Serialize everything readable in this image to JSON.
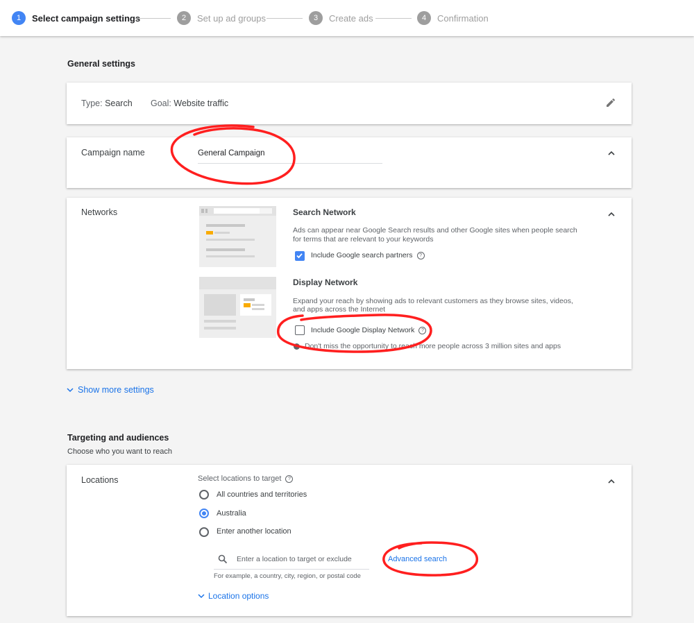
{
  "stepper": {
    "steps": [
      {
        "num": "1",
        "label": "Select campaign settings"
      },
      {
        "num": "2",
        "label": "Set up ad groups"
      },
      {
        "num": "3",
        "label": "Create ads"
      },
      {
        "num": "4",
        "label": "Confirmation"
      }
    ],
    "active_step": 1
  },
  "general": {
    "title": "General settings",
    "type_label": "Type:",
    "type_value": "Search",
    "goal_label": "Goal:",
    "goal_value": "Website traffic",
    "campaign_name_label": "Campaign name",
    "campaign_name_value": "General Campaign"
  },
  "networks": {
    "label": "Networks",
    "search": {
      "title": "Search Network",
      "desc_line1": "Ads can appear near Google Search results and other Google sites when people search",
      "desc_line2": "for terms that are relevant to your keywords",
      "checkbox_label": "Include Google search partners",
      "checked": true
    },
    "display": {
      "title": "Display Network",
      "desc_line1": "Expand your reach by showing ads to relevant customers as they browse sites, videos,",
      "desc_line2": "and apps across the Internet",
      "checkbox_label": "Include Google Display Network",
      "checked": false,
      "hint": "Don't miss the opportunity to reach more people across 3 million sites and apps"
    }
  },
  "show_more": "Show more settings",
  "targeting": {
    "title": "Targeting and audiences",
    "subtitle": "Choose who you want to reach",
    "locations_label": "Locations",
    "select_prompt": "Select locations to target",
    "options": [
      "All countries and territories",
      "Australia",
      "Enter another location"
    ],
    "selected_option": "Australia",
    "search_placeholder": "Enter a location to target or exclude",
    "search_hint": "For example, a country, city, region, or postal code",
    "advanced_search": "Advanced search",
    "location_options": "Location options"
  },
  "colors": {
    "accent": "#4285f4",
    "link": "#1a73e8",
    "annotation": "#ff1f1f",
    "background": "#f4f4f4"
  }
}
